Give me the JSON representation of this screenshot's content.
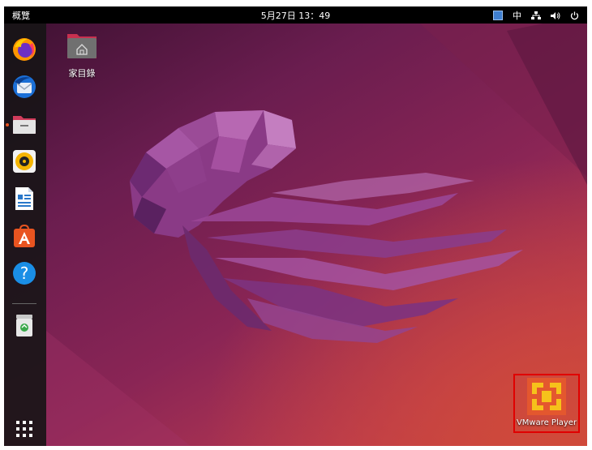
{
  "topbar": {
    "activities_label": "概覽",
    "clock": "5月27日 13：49",
    "input_method": "中"
  },
  "dock": {
    "items": [
      {
        "name": "firefox",
        "icon": "firefox-icon"
      },
      {
        "name": "thunderbird",
        "icon": "thunderbird-icon"
      },
      {
        "name": "files",
        "icon": "files-icon",
        "running": true
      },
      {
        "name": "rhythmbox",
        "icon": "rhythmbox-icon"
      },
      {
        "name": "libreoffice-writer",
        "icon": "writer-icon"
      },
      {
        "name": "ubuntu-software",
        "icon": "software-icon"
      },
      {
        "name": "help",
        "icon": "help-icon"
      },
      {
        "name": "trash",
        "icon": "trash-icon"
      },
      {
        "name": "show-applications",
        "icon": "app-grid-icon"
      }
    ]
  },
  "desktop": {
    "home_folder_label": "家目錄",
    "vmware_label": "VMware Player"
  },
  "colors": {
    "topbar": "#000000",
    "ubuntu_orange": "#e95420",
    "highlight": "#e00000"
  }
}
